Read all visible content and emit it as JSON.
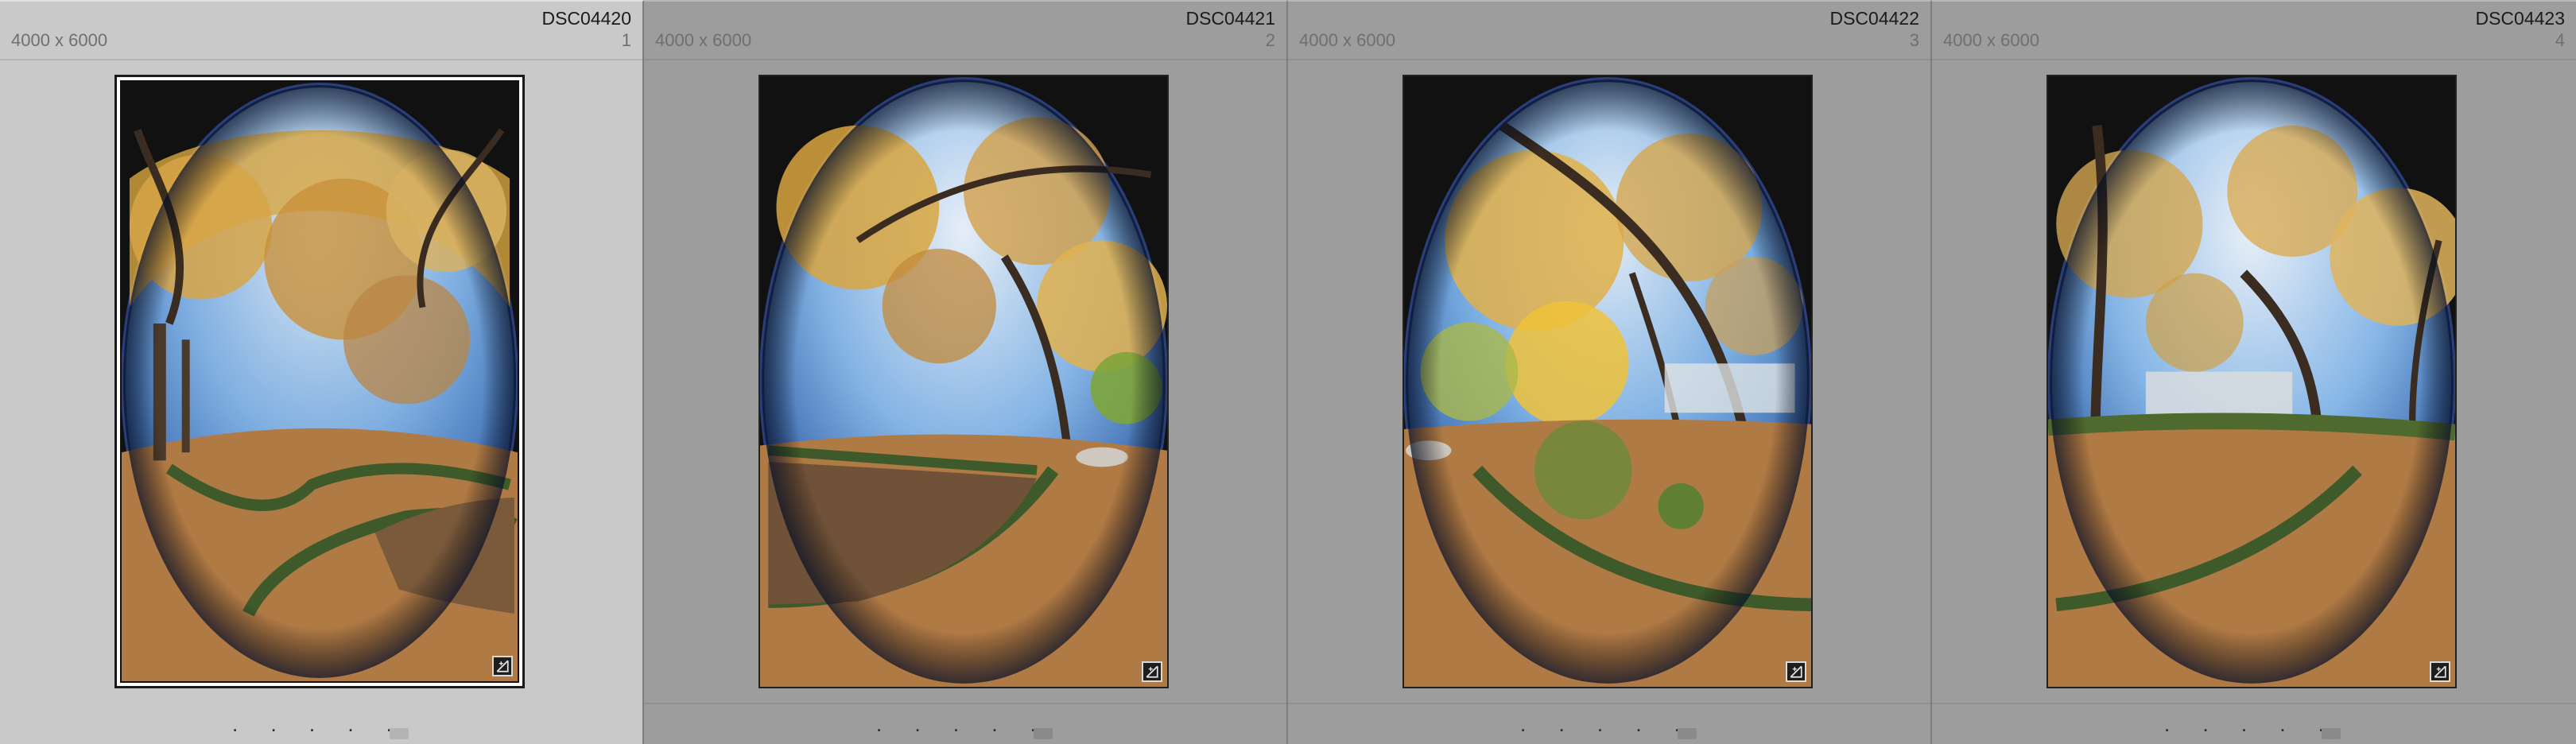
{
  "grid": {
    "cells": [
      {
        "filename": "DSC04420",
        "dimensions": "4000 x 6000",
        "index": "1",
        "selected": true,
        "rating_dots": ". . . . ."
      },
      {
        "filename": "DSC04421",
        "dimensions": "4000 x 6000",
        "index": "2",
        "selected": false,
        "rating_dots": ". . . . ."
      },
      {
        "filename": "DSC04422",
        "dimensions": "4000 x 6000",
        "index": "3",
        "selected": false,
        "rating_dots": ". . . . ."
      },
      {
        "filename": "DSC04423",
        "dimensions": "4000 x 6000",
        "index": "4",
        "selected": false,
        "rating_dots": ". . . . ."
      }
    ]
  },
  "icons": {
    "adjust_badge": "develop-adjustments-icon",
    "flag": "flag-icon"
  },
  "colors": {
    "selected_cell_bg": "#c9c9c9",
    "cell_bg": "#9d9d9d",
    "foliage": "#d9a640",
    "sky": "#6fa5dc",
    "ground": "#b07a45",
    "hedge": "#3f5a2a"
  }
}
